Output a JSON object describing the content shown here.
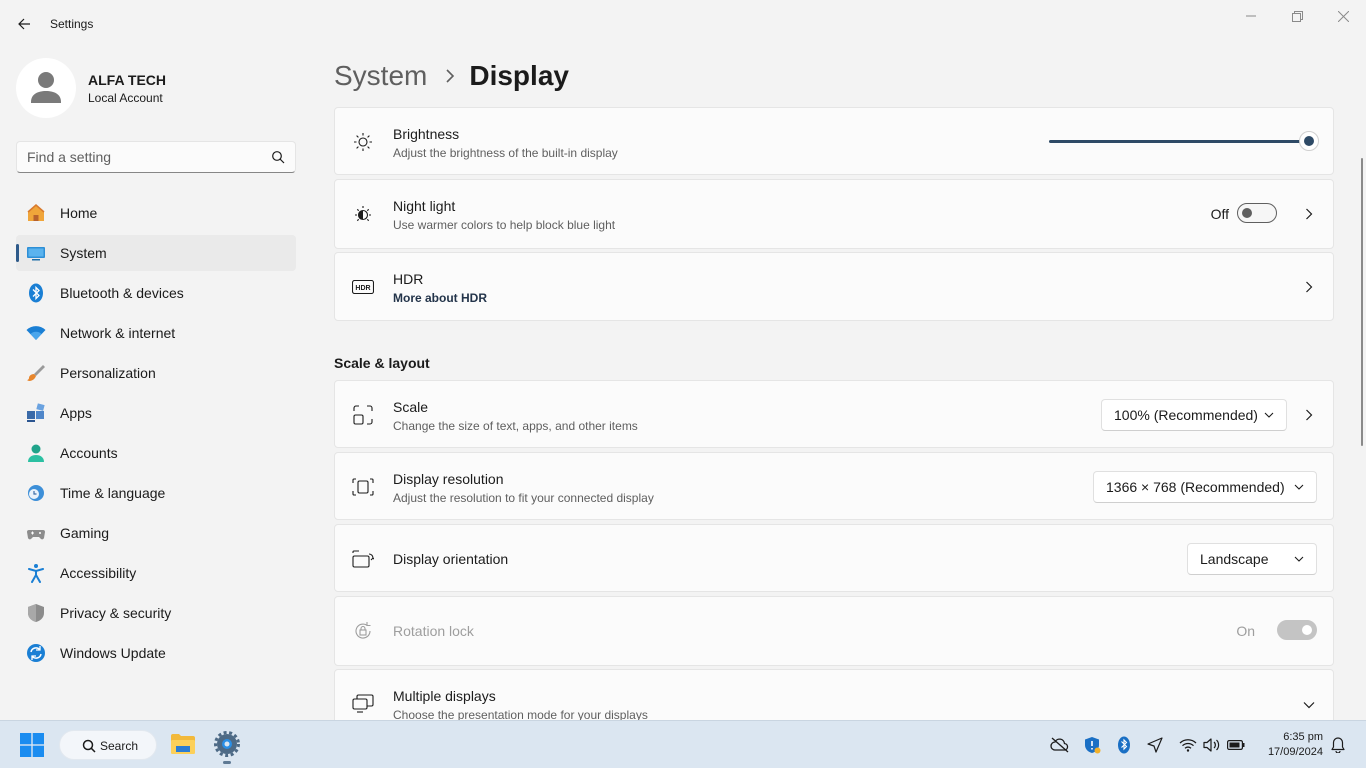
{
  "window": {
    "title": "Settings"
  },
  "profile": {
    "name": "ALFA TECH",
    "account_type": "Local Account"
  },
  "search": {
    "placeholder": "Find a setting"
  },
  "nav": {
    "items": [
      {
        "label": "Home",
        "icon": "home-icon"
      },
      {
        "label": "System",
        "icon": "system-icon",
        "active": true
      },
      {
        "label": "Bluetooth & devices",
        "icon": "bluetooth-icon"
      },
      {
        "label": "Network & internet",
        "icon": "wifi-icon"
      },
      {
        "label": "Personalization",
        "icon": "brush-icon"
      },
      {
        "label": "Apps",
        "icon": "apps-icon"
      },
      {
        "label": "Accounts",
        "icon": "accounts-icon"
      },
      {
        "label": "Time & language",
        "icon": "clock-globe-icon"
      },
      {
        "label": "Gaming",
        "icon": "gamepad-icon"
      },
      {
        "label": "Accessibility",
        "icon": "accessibility-icon"
      },
      {
        "label": "Privacy & security",
        "icon": "shield-icon"
      },
      {
        "label": "Windows Update",
        "icon": "update-icon"
      }
    ]
  },
  "breadcrumb": {
    "parent": "System",
    "current": "Display"
  },
  "brightness": {
    "title": "Brightness",
    "subtitle": "Adjust the brightness of the built-in display",
    "value": 100
  },
  "night_light": {
    "title": "Night light",
    "subtitle": "Use warmer colors to help block blue light",
    "state": "Off"
  },
  "hdr": {
    "title": "HDR",
    "link": "More about HDR"
  },
  "scale_layout": {
    "heading": "Scale & layout"
  },
  "scale": {
    "title": "Scale",
    "subtitle": "Change the size of text, apps, and other items",
    "value": "100% (Recommended)"
  },
  "resolution": {
    "title": "Display resolution",
    "subtitle": "Adjust the resolution to fit your connected display",
    "value": "1366 × 768 (Recommended)"
  },
  "orientation": {
    "title": "Display orientation",
    "value": "Landscape"
  },
  "rotation_lock": {
    "title": "Rotation lock",
    "state": "On"
  },
  "multiple_displays": {
    "title": "Multiple displays",
    "subtitle": "Choose the presentation mode for your displays"
  },
  "taskbar": {
    "search_label": "Search",
    "time": "6:35 pm",
    "date": "17/09/2024"
  },
  "colors": {
    "accent": "#2e4a66",
    "background": "#f3f3f3",
    "card": "#fbfbfb"
  }
}
